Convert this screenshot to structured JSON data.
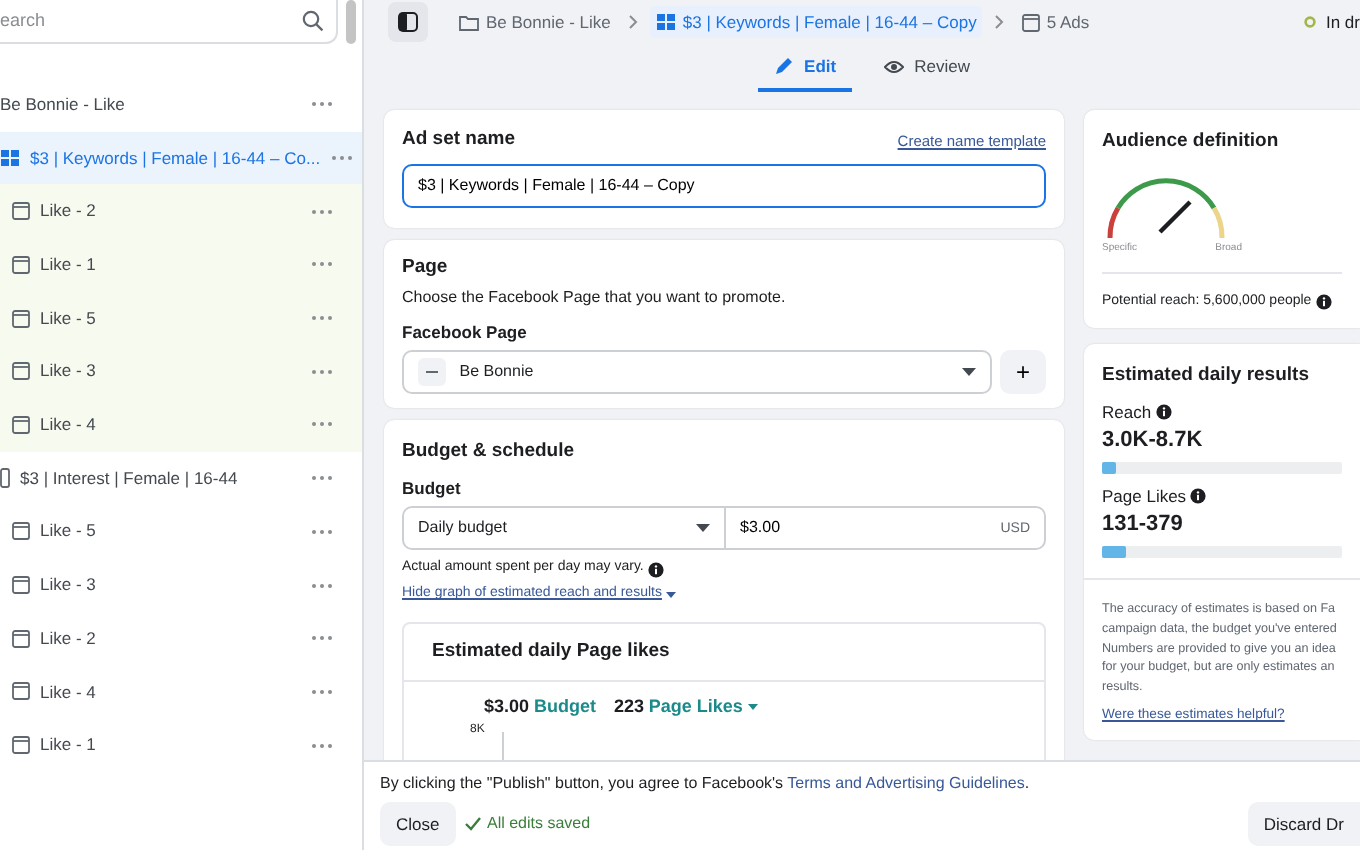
{
  "sidebar": {
    "search": {
      "placeholder": "earch"
    },
    "tree": [
      {
        "label": "Be Bonnie - Like",
        "kind": "campaign",
        "selected": false,
        "children": [
          {
            "label": "$3 | Keywords | Female | 16-44 – Co...",
            "kind": "adset",
            "selected": true,
            "children": [
              {
                "label": "Like - 2",
                "kind": "ad",
                "selected": false
              },
              {
                "label": "Like - 1",
                "kind": "ad",
                "selected": false
              },
              {
                "label": "Like - 5",
                "kind": "ad",
                "selected": false
              },
              {
                "label": "Like - 3",
                "kind": "ad",
                "selected": false
              },
              {
                "label": "Like - 4",
                "kind": "ad",
                "selected": false
              }
            ]
          },
          {
            "label": "$3 | Interest | Female | 16-44",
            "kind": "adset",
            "selected": false,
            "children": [
              {
                "label": "Like - 5",
                "kind": "ad",
                "selected": false
              },
              {
                "label": "Like - 3",
                "kind": "ad",
                "selected": false
              },
              {
                "label": "Like - 2",
                "kind": "ad",
                "selected": false
              },
              {
                "label": "Like - 4",
                "kind": "ad",
                "selected": false
              },
              {
                "label": "Like - 1",
                "kind": "ad",
                "selected": false
              }
            ]
          }
        ]
      }
    ]
  },
  "header": {
    "breadcrumb": [
      {
        "label": "Be Bonnie - Like",
        "kind": "campaign",
        "selected": false
      },
      {
        "label": "$3 | Keywords | Female | 16-44 – Copy",
        "kind": "adset",
        "selected": true
      },
      {
        "label": "5 Ads",
        "kind": "ad",
        "selected": false
      }
    ],
    "status": "In dr",
    "tabs": [
      {
        "label": "Edit",
        "kind": "edit",
        "selected": true
      },
      {
        "label": "Review",
        "kind": "review",
        "selected": false
      }
    ]
  },
  "ad_set_name": {
    "title": "Ad set name",
    "link": "Create name template",
    "value": "$3 | Keywords | Female | 16-44 – Copy"
  },
  "page": {
    "title": "Page",
    "description": "Choose the Facebook Page that you want to promote.",
    "field_label": "Facebook Page",
    "value": "Be Bonnie",
    "add_button": "+"
  },
  "budget": {
    "title": "Budget & schedule",
    "field_label": "Budget",
    "type_value": "Daily budget",
    "amount": "$3.00",
    "currency": "USD",
    "note": "Actual amount spent per day may vary.",
    "toggle_link": "Hide graph of estimated reach and results",
    "graph": {
      "title": "Estimated daily Page likes",
      "budget_value": "$3.00",
      "budget_label": "Budget",
      "result_value": "223",
      "result_label": "Page Likes",
      "axis_label": "8K"
    }
  },
  "audience": {
    "title": "Audience definition",
    "gauge_labels": [
      "Specific",
      "Broad"
    ],
    "potential_reach": "Potential reach: 5,600,000 people"
  },
  "estimates": {
    "title": "Estimated daily results",
    "metrics": [
      {
        "label": "Reach",
        "value": "3.0K-8.7K",
        "level": 0.06
      },
      {
        "label": "Page Likes",
        "value": "131-379",
        "level": 0.1
      }
    ],
    "disclaimer_lines": [
      "The accuracy of estimates is based on Fa",
      "campaign data, the budget you've entered",
      "Numbers are provided to give you an idea",
      "for your budget, but are only estimates an",
      "results."
    ],
    "feedback_link": "Were these estimates helpful?"
  },
  "footer": {
    "agreement": "By clicking the \"Publish\" button, you agree to Facebook's ",
    "agreement_link": "Terms and Advertising Guidelines",
    "agreement_end": ".",
    "close_button": "Close",
    "save_status": "All edits saved",
    "discard_button": "Discard Dr"
  }
}
